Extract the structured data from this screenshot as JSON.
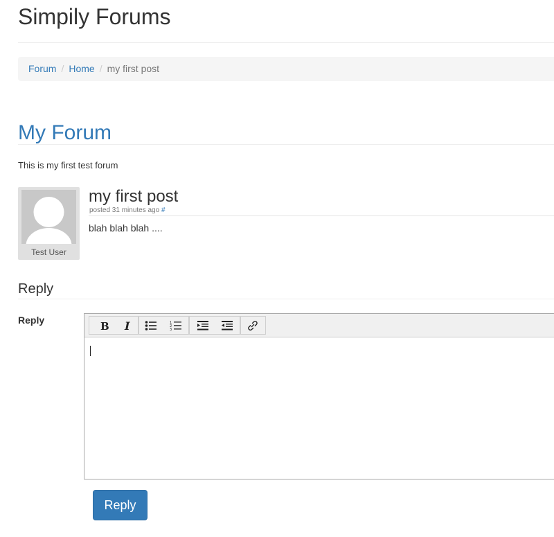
{
  "site": {
    "title": "Simpily Forums"
  },
  "breadcrumb": {
    "items": [
      {
        "label": "Forum"
      },
      {
        "label": "Home"
      }
    ],
    "separator": "/",
    "current": "my first post"
  },
  "forum": {
    "title": "My Forum",
    "description": "This is my first test forum"
  },
  "post": {
    "author": "Test User",
    "title": "my first post",
    "meta": "posted 31 minutes ago",
    "permalink": "#",
    "body": "blah blah blah ...."
  },
  "reply": {
    "heading": "Reply",
    "field_label": "Reply",
    "submit_label": "Reply",
    "toolbar_icons": [
      "bold-icon",
      "italic-icon",
      "bullet-list-icon",
      "numbered-list-icon",
      "indent-icon",
      "outdent-icon",
      "link-icon"
    ]
  },
  "colors": {
    "link": "#337ab7",
    "primary_button": "#337ab7"
  }
}
